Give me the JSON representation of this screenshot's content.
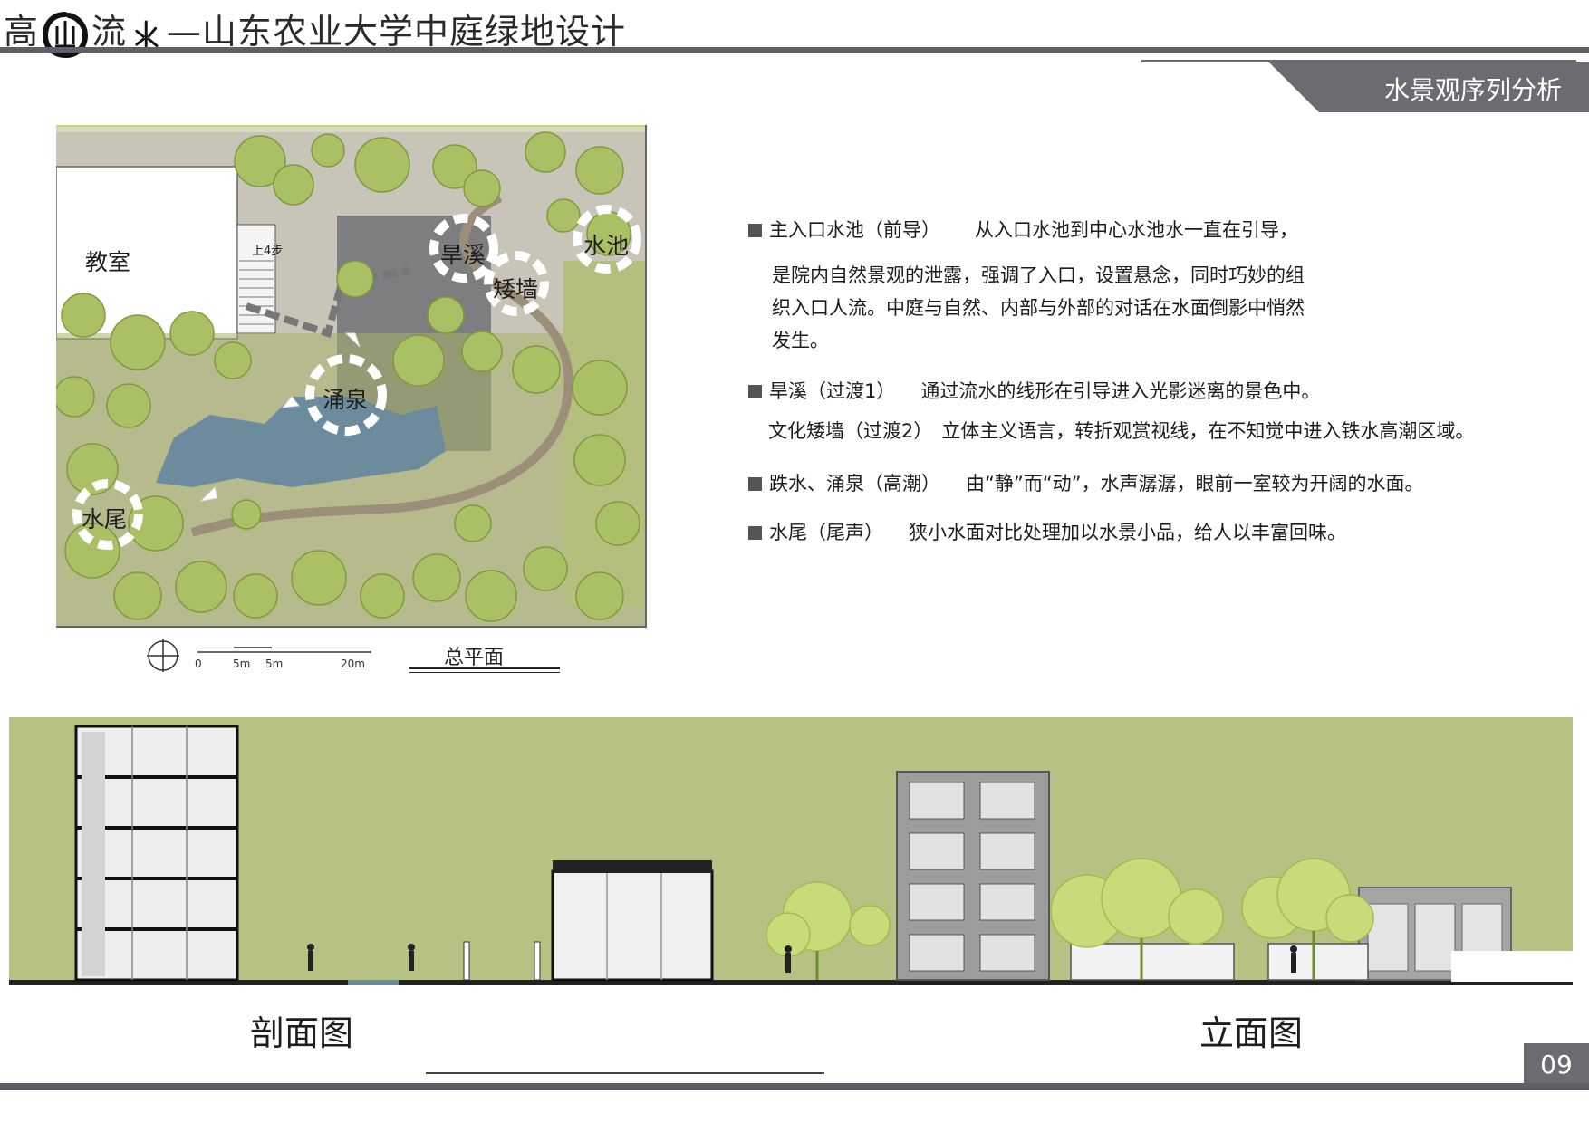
{
  "header": {
    "title_part1": "高",
    "title_part2": "流",
    "title_part3": "—山东农业大学中庭绿地设计",
    "section_title": "水景观序列分析"
  },
  "plan": {
    "labels": {
      "classroom": "教室",
      "steps": "上4步",
      "dry_creek": "旱溪",
      "low_wall": "矮墙",
      "pool": "水池",
      "fountain": "涌泉",
      "tail": "水尾"
    },
    "scale": {
      "t0": "0",
      "t1": "5m",
      "t2": "5m",
      "t3": "20m"
    },
    "title": "总平面"
  },
  "description": {
    "items": [
      {
        "head": "主入口水池（前导）",
        "body": "从入口水池到中心水池水一直在引导，"
      },
      {
        "line": "是院内自然景观的泄露，强调了入口，设置悬念，同时巧妙的组"
      },
      {
        "line": "织入口人流。中庭与自然、内部与外部的对话在水面倒影中悄然"
      },
      {
        "line": "发生。"
      },
      {
        "head": "旱溪（过渡1）",
        "body": "通过流水的线形在引导进入光影迷离的景色中。"
      },
      {
        "head": "文化矮墙（过渡2）",
        "body": "立体主义语言，转折观赏视线，在不知觉中进入铁水高潮区域。"
      },
      {
        "head": "跌水、涌泉（高潮）",
        "body": "由“静”而“动”，水声潺潺，眼前一室较为开阔的水面。"
      },
      {
        "head": "水尾（尾声）",
        "body": "狭小水面对比处理加以水景小品，给人以丰富回味。"
      }
    ]
  },
  "elevation": {
    "section_title": "剖面图",
    "elevation_title": "立面图"
  },
  "footer": {
    "page_number": "09"
  },
  "colors": {
    "accent_gray": "#6b6b72",
    "band_green": "#b6c183",
    "water_blue": "#6c8c9e",
    "tree_green": "#a9c164"
  }
}
